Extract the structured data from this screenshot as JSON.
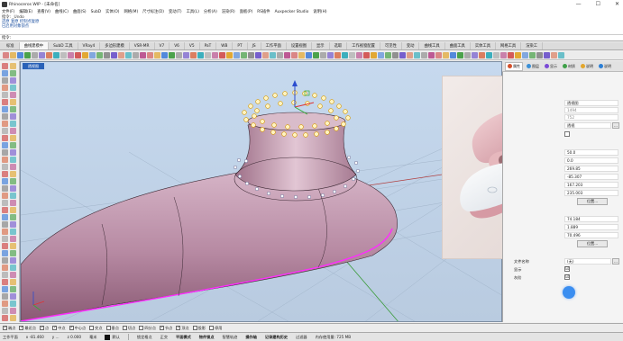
{
  "window": {
    "title": "Rhinoceros WIP - [未命名]",
    "controls": {
      "minimize": "—",
      "maximize": "☐",
      "close": "✕"
    }
  },
  "menu": [
    "文件(F)",
    "编辑(E)",
    "查看(V)",
    "曲线(C)",
    "曲面(S)",
    "SubD",
    "实体(O)",
    "网格(M)",
    "尺寸标注(D)",
    "变动(T)",
    "工具(L)",
    "分析(A)",
    "渲染(R)",
    "面板(P)",
    "RS插件",
    "Auxpecker Studio",
    "说明(H)"
  ],
  "command_history": {
    "line1": "指令: _Undo",
    "line2": "还原 复原 控制点复原",
    "line3": "已启用对象锁点"
  },
  "command_prompt": "指令:",
  "tabs": [
    "标准",
    "工作平面",
    "设置视图",
    "显示",
    "选取",
    "工作视窗配置",
    "可见性",
    "变动",
    "曲线工具",
    "曲面工具",
    "实体工具",
    "网格工具",
    "渲染工具",
    "出图",
    "V7新功能",
    "VRay4",
    "多边形建模",
    "VSR-MR",
    "V7",
    "V6",
    "V5",
    "PaT",
    "WB",
    "PT",
    "JS",
    "工作平面",
    "设置视图",
    "显示",
    "选取",
    "工作视窗配置",
    "可见性",
    "变动",
    "曲线工具",
    "曲面工具",
    "实体工具",
    "网格工具",
    "渲染工具"
  ],
  "visible_tabs": [
    "标准",
    "曲线建模中",
    "SubD 工具",
    "VRay4",
    "多边形建模",
    "VSR-MR",
    "V7",
    "V6",
    "V5",
    "PaT",
    "WB",
    "PT",
    "JS",
    "工作平面",
    "设置视图",
    "显示",
    "选取",
    "工作视窗配置",
    "可见性",
    "变动",
    "曲线工具",
    "曲面工具",
    "实体工具",
    "网格工具",
    "渲染工"
  ],
  "active_tab": "曲线建模中",
  "viewport": {
    "label": "透视图"
  },
  "right_panel": {
    "tabs": [
      "属性",
      "图层",
      "显示",
      "材质",
      "说明",
      "说明"
    ],
    "rows": [
      {
        "label": "",
        "value": "透视图"
      },
      {
        "label": "",
        "value": "1494"
      },
      {
        "label": "",
        "value": "752"
      },
      {
        "label": "",
        "value": "透视"
      }
    ],
    "num_rows": [
      "50.0",
      "0.0",
      "269.85",
      "-85.307",
      "167.203",
      "235.003"
    ],
    "button1": "位置...",
    "num_rows2": [
      "74.184",
      "1.889",
      "70.496"
    ],
    "button2": "位置...",
    "bottom_rows": [
      {
        "label": "文件名称",
        "value": "(无)"
      },
      {
        "label": "显示",
        "value": "☑"
      },
      {
        "label": "灰阶",
        "value": "☑"
      }
    ]
  },
  "osnaps": [
    {
      "label": "端点",
      "checked": true
    },
    {
      "label": "最近点",
      "checked": true
    },
    {
      "label": "点",
      "checked": true
    },
    {
      "label": "中点",
      "checked": true
    },
    {
      "label": "中心点",
      "checked": true
    },
    {
      "label": "交点",
      "checked": false
    },
    {
      "label": "垂点",
      "checked": false
    },
    {
      "label": "切点",
      "checked": false
    },
    {
      "label": "四分点",
      "checked": false
    },
    {
      "label": "节点",
      "checked": true
    },
    {
      "label": "顶点",
      "checked": true
    },
    {
      "label": "投影",
      "checked": false
    },
    {
      "label": "停用",
      "checked": false
    }
  ],
  "status": {
    "cplane": "工作平面",
    "x": "x -81.460",
    "y": "y ...",
    "z": "z 0.000",
    "unit": "毫米",
    "layer": "默认",
    "items": [
      "锁定格点",
      "正交",
      "平面模式",
      "物件锁点",
      "智慧轨迹",
      "操作轴",
      "记录建构历史",
      "过滤器"
    ],
    "memory": "内存使用量: 725 MB",
    "bold_items": [
      "平面模式",
      "物件锁点",
      "操作轴",
      "记录建构历史"
    ]
  },
  "colors": {
    "accent": "#2a62b8",
    "surface_pink": "#caa6b8",
    "edge_magenta": "#ff2bff",
    "control_point_yellow": "#ffd24a"
  }
}
